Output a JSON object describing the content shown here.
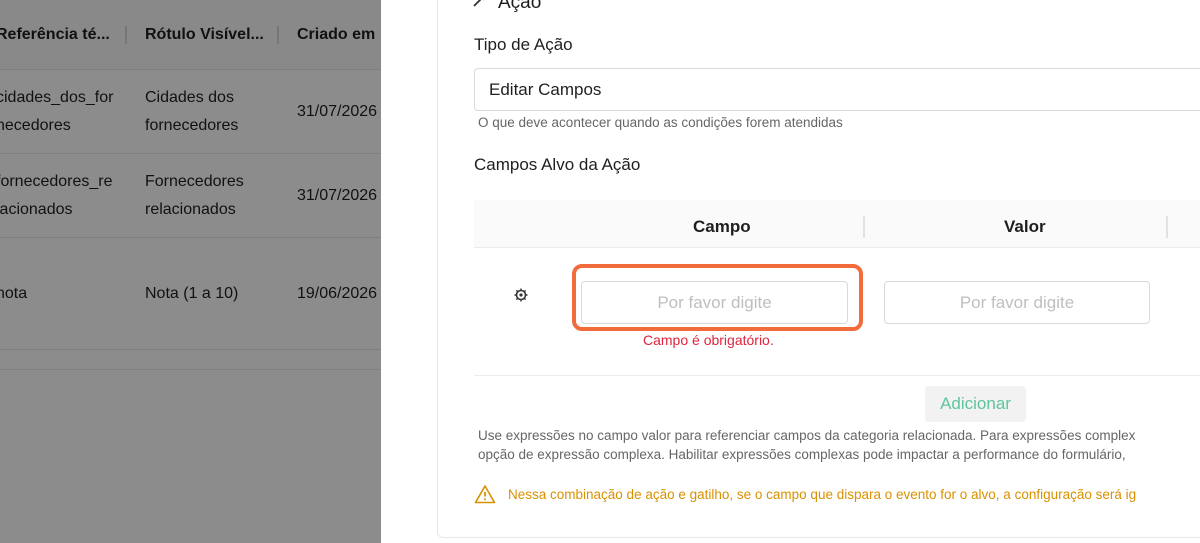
{
  "table": {
    "headers": [
      "Referência té...",
      "Rótulo Visível...",
      "Criado em"
    ],
    "rows": [
      {
        "ref": [
          "cidades_dos_for",
          "necedores"
        ],
        "label": [
          "Cidades dos",
          "fornecedores"
        ],
        "created": "31/07/2026"
      },
      {
        "ref": [
          "fornecedores_re",
          "lacionados"
        ],
        "label": [
          "Fornecedores",
          "relacionados"
        ],
        "created": "31/07/2026"
      },
      {
        "ref": [
          "nota"
        ],
        "label": [
          "Nota (1 a 10)"
        ],
        "created": "19/06/2026"
      }
    ]
  },
  "action": {
    "section_title": "Ação",
    "type_label": "Tipo de Ação",
    "type_value": "Editar Campos",
    "type_help": "O que deve acontecer quando as condições forem atendidas",
    "targets_label": "Campos Alvo da Ação",
    "columns": {
      "field": "Campo",
      "value": "Valor"
    },
    "field_placeholder": "Por favor digite",
    "value_placeholder": "Por favor digite",
    "field_error": "Campo é obrigatório.",
    "add_button": "Adicionar",
    "expr_help_line1": "Use expressões no campo valor para referenciar campos da categoria relacionada. Para expressões complex",
    "expr_help_line2": "opção de expressão complexa. Habilitar expressões complexas pode impactar a performance do formulário,",
    "warning": "Nessa combinação de ação e gatilho, se o campo que dispara o evento for o alvo, a configuração será ig"
  },
  "colors": {
    "highlight": "#f26b3a",
    "error": "#e0243d",
    "add": "#5ec69a",
    "warning": "#d99100"
  }
}
